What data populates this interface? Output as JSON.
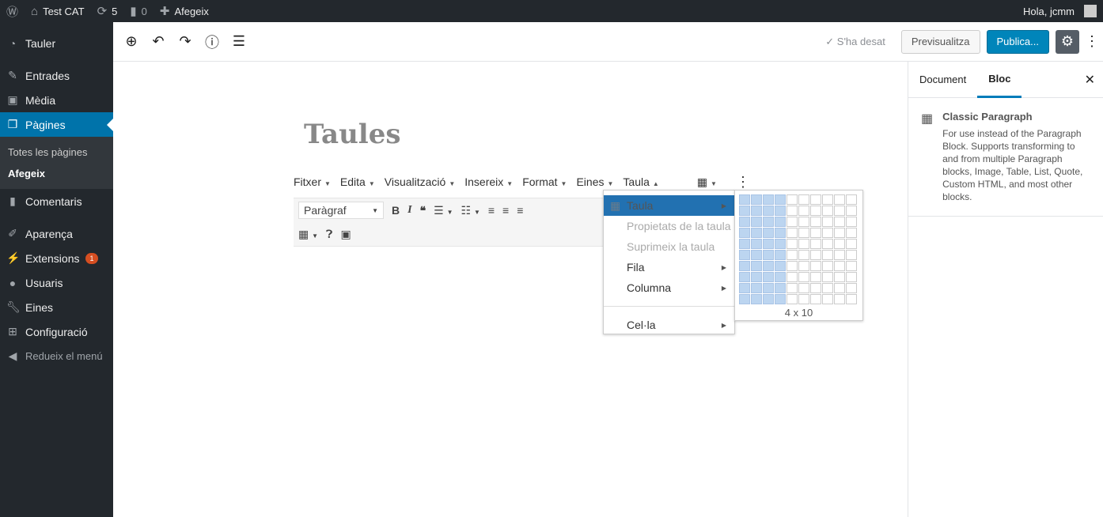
{
  "adminbar": {
    "site": "Test CAT",
    "updates": "5",
    "comments": "0",
    "new": "Afegeix",
    "greeting": "Hola, jcmm"
  },
  "sidebar": {
    "items": [
      {
        "label": "Tauler",
        "icon": "dashboard-icon"
      },
      {
        "label": "Entrades",
        "icon": "pin-icon"
      },
      {
        "label": "Mèdia",
        "icon": "media-icon"
      },
      {
        "label": "Pàgines",
        "icon": "pages-icon"
      },
      {
        "label": "Comentaris",
        "icon": "comment-icon"
      },
      {
        "label": "Aparença",
        "icon": "brush-icon"
      },
      {
        "label": "Extensions",
        "icon": "plugin-icon",
        "badge": "1"
      },
      {
        "label": "Usuaris",
        "icon": "user-icon"
      },
      {
        "label": "Eines",
        "icon": "wrench-icon"
      },
      {
        "label": "Configuració",
        "icon": "settings-icon"
      }
    ],
    "submenu": [
      "Totes les pàgines",
      "Afegeix"
    ],
    "collapse": "Redueix el menú"
  },
  "topbar": {
    "saved": "S'ha desat",
    "preview": "Previsualitza",
    "publish": "Publica..."
  },
  "editor": {
    "title": "Taules",
    "menus": [
      "Fitxer",
      "Edita",
      "Visualització",
      "Insereix",
      "Format",
      "Eines",
      "Taula"
    ],
    "format": "Paràgraf"
  },
  "table_menu": {
    "items": [
      "Taula",
      "Propietats de la taula",
      "Suprimeix la taula",
      "Fila",
      "Columna",
      "Cel·la"
    ],
    "grid_label": "4 x 10",
    "grid_cols": 10,
    "grid_rows": 10,
    "selected_cols": 4,
    "selected_rows": 10
  },
  "panel": {
    "tabs": [
      "Document",
      "Bloc"
    ],
    "block_name": "Classic Paragraph",
    "block_desc": "For use instead of the Paragraph Block. Supports transforming to and from multiple Paragraph blocks, Image, Table, List, Quote, Custom HTML, and most other blocks."
  }
}
